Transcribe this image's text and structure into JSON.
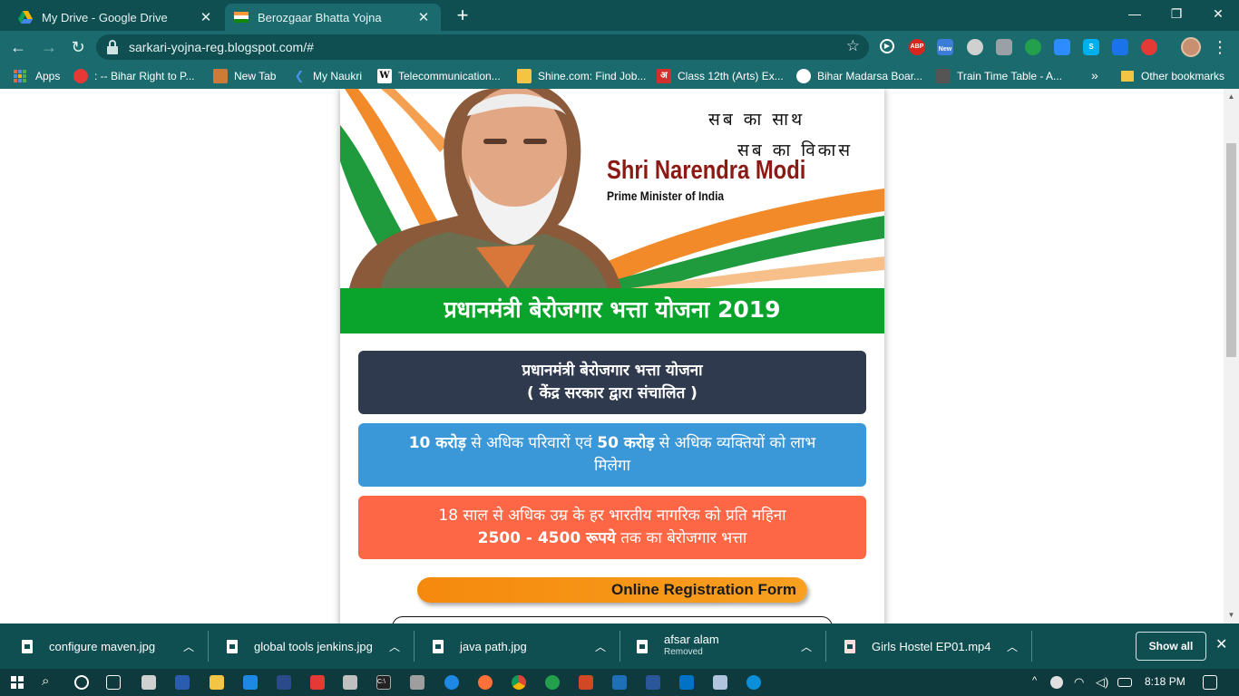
{
  "tabs": [
    {
      "title": "My Drive - Google Drive",
      "icon": "google-drive-icon"
    },
    {
      "title": "Berozgaar Bhatta Yojna",
      "icon": "india-flag-icon",
      "active": true
    }
  ],
  "toolbar": {
    "url": "sarkari-yojna-reg.blogspot.com/#",
    "extensions": [
      "youtube-icon",
      "adblock-plus-icon",
      "new-extension-icon",
      "record-icon",
      "camera-icon",
      "hangouts-icon",
      "zoom-icon",
      "skype-icon",
      "grid-extension-icon",
      "refresh-extension-icon"
    ],
    "abp_label": "ABP",
    "new_badge": "New"
  },
  "bookmarks": {
    "apps": "Apps",
    "items": [
      {
        "label": ": -- Bihar Right to P...",
        "icon": "airtel-icon"
      },
      {
        "label": "New Tab",
        "icon": "new-tab-icon"
      },
      {
        "label": "My Naukri",
        "icon": "naukri-icon"
      },
      {
        "label": "Telecommunication...",
        "icon": "wikipedia-icon"
      },
      {
        "label": "Shine.com: Find Job...",
        "icon": "shine-icon"
      },
      {
        "label": "Class 12th (Arts) Ex...",
        "icon": "amar-ujala-icon"
      },
      {
        "label": "Bihar Madarsa Boar...",
        "icon": "globe-icon"
      },
      {
        "label": "Train Time Table - A...",
        "icon": "train-icon"
      }
    ],
    "more": "»",
    "other": "Other bookmarks",
    "wikipedia_glyph": "W",
    "amar_ujala_glyph": "अ"
  },
  "banner": {
    "slogan_line1": "सब का साथ",
    "slogan_line2": "सब का विकास",
    "name": "Shri Narendra Modi",
    "role": "Prime Minister of India"
  },
  "page": {
    "heading": "प्रधानमंत्री बेरोजगार भत्ता योजना 2019",
    "box1_line1": "प्रधानमंत्री बेरोजगार भत्ता योजना",
    "box1_line2": "( केंद्र सरकार द्वारा संचालित )",
    "box2_num1": "10 करोड़",
    "box2_text1": " से अधिक परिवारों एवं ",
    "box2_num2": "50 करोड़",
    "box2_text2": " से अधिक व्यक्तियों को लाभ",
    "box2_line2": "मिलेगा",
    "box3_line1": "18 साल से अधिक उम्र के हर भारतीय नागरिक को प्रति महिना",
    "box3_amount": "2500 - 4500 रूपये",
    "box3_text2": " तक का बेरोजगार भत्ता",
    "register_button": "Online Registration Form"
  },
  "downloads": {
    "items": [
      {
        "name": "configure maven.jpg",
        "sub": ""
      },
      {
        "name": "global tools jenkins.jpg",
        "sub": ""
      },
      {
        "name": "java path.jpg",
        "sub": ""
      },
      {
        "name": "afsar alam",
        "sub": "Removed"
      },
      {
        "name": "Girls Hostel EP01.mp4",
        "sub": ""
      }
    ],
    "show_all": "Show all"
  },
  "taskbar": {
    "apps": [
      "search-icon",
      "cortana-icon",
      "task-view-icon",
      "store-icon",
      "powershell-icon",
      "file-explorer-icon",
      "mail-icon",
      "media-player-icon",
      "anydesk-icon",
      "snipping-icon",
      "cmd-icon",
      "tools-icon",
      "edge-legacy-icon",
      "firefox-icon",
      "chrome-icon",
      "hangouts-icon",
      "powerpoint-icon",
      "photos-icon",
      "word-icon",
      "outlook-icon",
      "notepad-icon",
      "edge-icon"
    ],
    "cmd_label": "C:\\",
    "clock": "8:18 PM",
    "tray_up": "^"
  }
}
